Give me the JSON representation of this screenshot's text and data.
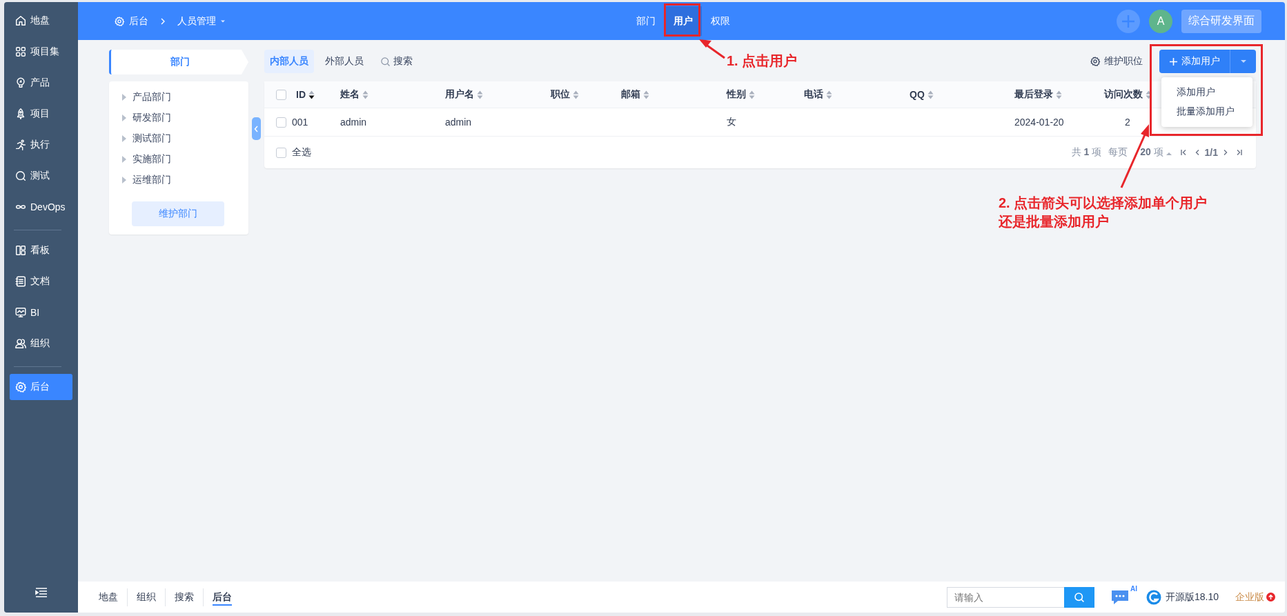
{
  "sidebar": {
    "groups": [
      [
        {
          "label": "地盘",
          "selected": false
        },
        {
          "label": "项目集",
          "selected": false
        },
        {
          "label": "产品",
          "selected": false
        },
        {
          "label": "项目",
          "selected": false
        },
        {
          "label": "执行",
          "selected": false
        },
        {
          "label": "测试",
          "selected": false
        },
        {
          "label": "DevOps",
          "selected": false
        }
      ],
      [
        {
          "label": "看板",
          "selected": false
        },
        {
          "label": "文档",
          "selected": false
        },
        {
          "label": "BI",
          "selected": false
        },
        {
          "label": "组织",
          "selected": false
        }
      ],
      [
        {
          "label": "后台",
          "selected": true
        }
      ]
    ]
  },
  "breadcrumb": {
    "root": "后台",
    "current": "人员管理"
  },
  "top_tabs": [
    {
      "label": "部门",
      "selected": false
    },
    {
      "label": "用户",
      "selected": true
    },
    {
      "label": "权限",
      "selected": false
    }
  ],
  "avatar": "A",
  "workspace_button": "综合研发界面",
  "dept_panel": {
    "title": "部门",
    "tree": [
      {
        "label": "产品部门",
        "expanded": false
      },
      {
        "label": "研发部门",
        "expanded": false
      },
      {
        "label": "测试部门",
        "expanded": false
      },
      {
        "label": "实施部门",
        "expanded": false
      },
      {
        "label": "运维部门",
        "expanded": false
      }
    ],
    "button": "维护部门"
  },
  "user_tabs": [
    {
      "label": "内部人员",
      "selected": true
    },
    {
      "label": "外部人员",
      "selected": false
    }
  ],
  "search_label": "搜索",
  "maintain_positions": "维护职位",
  "add_button": "添加用户",
  "add_menu": [
    {
      "label": "添加用户"
    },
    {
      "label": "批量添加用户"
    }
  ],
  "table": {
    "columns": [
      {
        "label": "ID",
        "sorted": true
      },
      {
        "label": "姓名",
        "sorted": false
      },
      {
        "label": "用户名",
        "sorted": false
      },
      {
        "label": "职位",
        "sorted": false
      },
      {
        "label": "邮箱",
        "sorted": false
      },
      {
        "label": "性别",
        "sorted": false
      },
      {
        "label": "电话",
        "sorted": false
      },
      {
        "label": "QQ",
        "sorted": false
      },
      {
        "label": "最后登录",
        "sorted": false
      },
      {
        "label": "访问次数",
        "sorted": false
      }
    ],
    "rows": [
      {
        "checked": false,
        "cells": [
          "001",
          "admin",
          "admin",
          null,
          null,
          "女",
          null,
          null,
          "2024-01-20",
          "2"
        ]
      }
    ],
    "select_all": {
      "label": "全选",
      "checked": false
    },
    "pagination": {
      "total_prefix": "共",
      "total": "1",
      "total_suffix": "项",
      "per_page_prefix": "每页",
      "per_page": "20",
      "per_page_suffix": "项",
      "page": "1/1"
    }
  },
  "annotations": [
    {
      "lines": [
        "1. 点击用户"
      ]
    },
    {
      "lines": [
        "2. 点击箭头可以选择添加单个用户",
        "还是批量添加用户"
      ]
    }
  ],
  "footer": {
    "tabs": [
      {
        "label": "地盘",
        "selected": false
      },
      {
        "label": "组织",
        "selected": false
      },
      {
        "label": "搜索",
        "selected": false
      },
      {
        "label": "后台",
        "selected": true
      }
    ],
    "search_placeholder": "请输入",
    "chat_badge": "AI",
    "edition": "开源版18.10",
    "enterprise": "企业版"
  }
}
